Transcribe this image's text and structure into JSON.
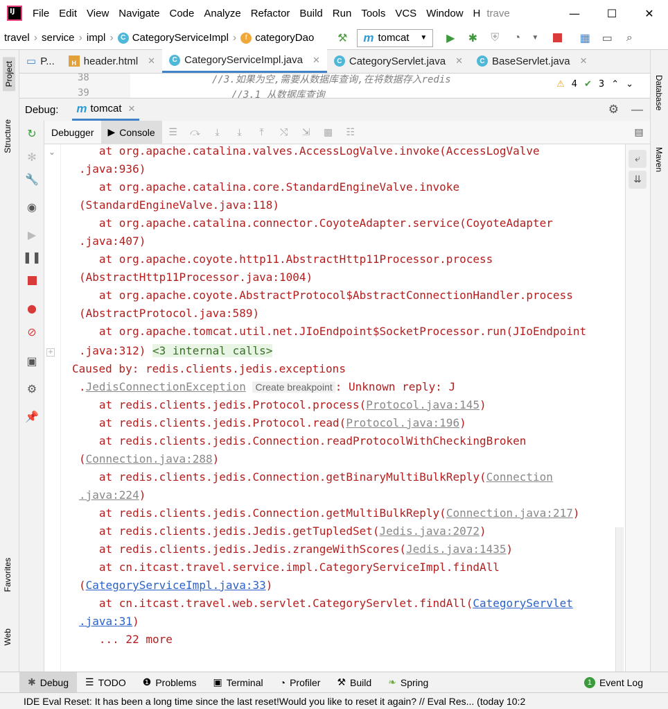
{
  "menu": [
    "File",
    "Edit",
    "View",
    "Navigate",
    "Code",
    "Analyze",
    "Refactor",
    "Build",
    "Run",
    "Tools",
    "VCS",
    "Window"
  ],
  "menu_extra": "trave",
  "breadcrumb": {
    "project": "travel",
    "pkg1": "service",
    "pkg2": "impl",
    "cls": "CategoryServiceImpl",
    "field": "categoryDao"
  },
  "run_config": "tomcat",
  "tabs": [
    {
      "label": "P..."
    },
    {
      "label": "header.html"
    },
    {
      "label": "CategoryServiceImpl.java"
    },
    {
      "label": "CategoryServlet.java"
    },
    {
      "label": "BaseServlet.java"
    }
  ],
  "editor": {
    "line1": "38",
    "line2": "39",
    "comment1": "//3.如果为空,需要从数据库查询,在将数据存入redis",
    "comment2": "//3.1 从数据库查询",
    "warnings": "4",
    "checks": "3"
  },
  "debug": {
    "label": "Debug:",
    "session": "tomcat",
    "debugger_tab": "Debugger",
    "console_tab": "Console"
  },
  "console": {
    "l1": "   at org.apache.catalina.valves.AccessLogValve.invoke(AccessLogValve",
    "l2": ".java:936)",
    "l3": "   at org.apache.catalina.core.StandardEngineValve.invoke",
    "l4": "(StandardEngineValve.java:118)",
    "l5": "   at org.apache.catalina.connector.CoyoteAdapter.service(CoyoteAdapter",
    "l6": ".java:407)",
    "l7": "   at org.apache.coyote.http11.AbstractHttp11Processor.process",
    "l8": "(AbstractHttp11Processor.java:1004)",
    "l9": "   at org.apache.coyote.AbstractProtocol$AbstractConnectionHandler.process",
    "l10": "(AbstractProtocol.java:589)",
    "l11": "   at org.apache.tomcat.util.net.JIoEndpoint$SocketProcessor.run(JIoEndpoint",
    "l12a": ".java:312) ",
    "l12b": "<3 internal calls>",
    "l13": "Caused by: redis.clients.jedis.exceptions",
    "l14a": ".",
    "l14b": "JedisConnectionException",
    "l14hint": "Create breakpoint",
    "l14c": ": Unknown reply: J",
    "l15a": "   at redis.clients.jedis.Protocol.process(",
    "l15b": "Protocol.java:145",
    "l16a": "   at redis.clients.jedis.Protocol.read(",
    "l16b": "Protocol.java:196",
    "l17": "   at redis.clients.jedis.Connection.readProtocolWithCheckingBroken",
    "l18b": "Connection.java:288",
    "l19a": "   at redis.clients.jedis.Connection.getBinaryMultiBulkReply(",
    "l19b": "Connection",
    "l20b": ".java:224",
    "l21a": "   at redis.clients.jedis.Connection.getMultiBulkReply(",
    "l21b": "Connection.java:217",
    "l22a": "   at redis.clients.jedis.Jedis.getTupledSet(",
    "l22b": "Jedis.java:2072",
    "l23a": "   at redis.clients.jedis.Jedis.zrangeWithScores(",
    "l23b": "Jedis.java:1435",
    "l24": "   at cn.itcast.travel.service.impl.CategoryServiceImpl.findAll",
    "l25b": "CategoryServiceImpl.java:33",
    "l26a": "   at cn.itcast.travel.web.servlet.CategoryServlet.findAll(",
    "l26b": "CategoryServlet",
    "l27b": ".java:31",
    "l28": "   ... 22 more"
  },
  "side_tabs": {
    "project": "Project",
    "structure": "Structure",
    "favorites": "Favorites",
    "web": "Web",
    "database": "Database",
    "maven": "Maven"
  },
  "bottom": [
    "Debug",
    "TODO",
    "Problems",
    "Terminal",
    "Profiler",
    "Build",
    "Spring"
  ],
  "event_log": {
    "count": "1",
    "label": "Event Log"
  },
  "status": "IDE Eval Reset: It has been a long time since the last reset!Would you like to reset it again? // Eval Res... (today 10:2"
}
